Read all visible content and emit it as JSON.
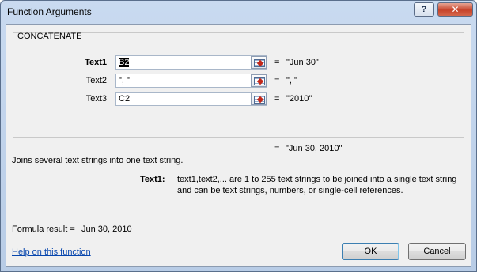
{
  "window": {
    "title": "Function Arguments",
    "help_icon_label": "?",
    "close_icon_label": "✕"
  },
  "function": {
    "name": "CONCATENATE",
    "arguments": [
      {
        "label": "Text1",
        "value_selected": "B2",
        "result_eq": "=",
        "result": "\"Jun 30\""
      },
      {
        "label": "Text2",
        "value": "\", \"",
        "result_eq": "=",
        "result": "\", \""
      },
      {
        "label": "Text3",
        "value": "C2",
        "result_eq": "=",
        "result": "\"2010\""
      }
    ],
    "overall_eq": "=",
    "overall_result": "\"Jun 30, 2010\"",
    "description": "Joins several text strings into one text string.",
    "arg_help_label": "Text1:",
    "arg_help_line1": "text1,text2,... are 1 to 255 text strings to be joined into a single text string",
    "arg_help_line2": "and can be text strings, numbers, or single-cell references."
  },
  "footer": {
    "formula_result_label": "Formula result =",
    "formula_result_value": "Jun 30, 2010",
    "help_link": "Help on this function",
    "ok_label": "OK",
    "cancel_label": "Cancel"
  }
}
